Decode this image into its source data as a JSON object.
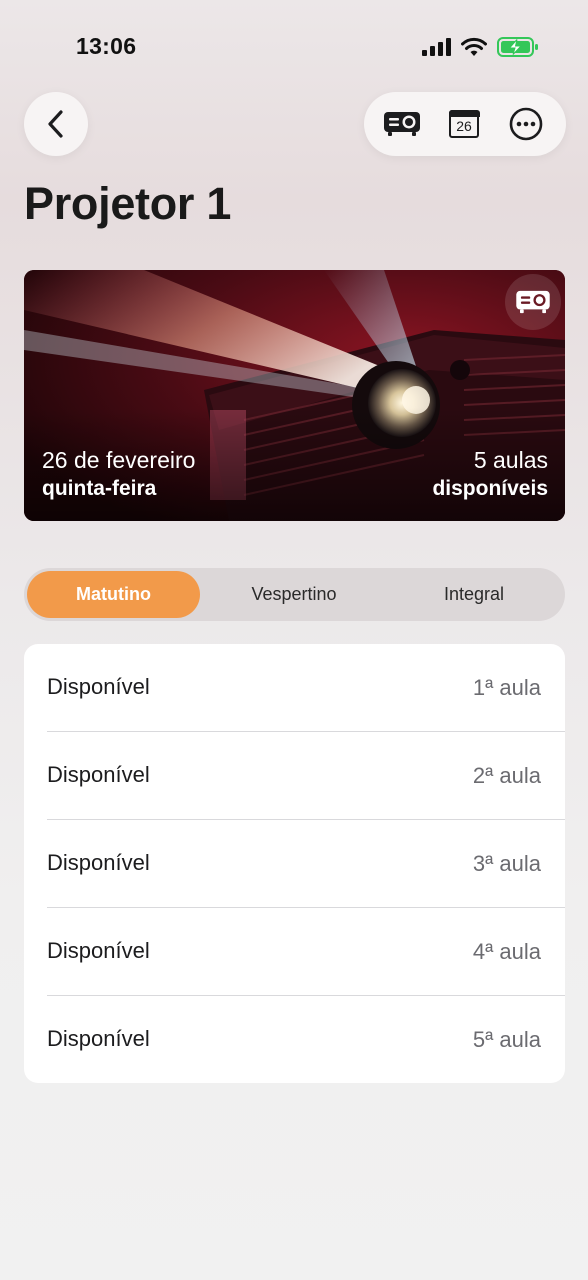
{
  "status_bar": {
    "time": "13:06"
  },
  "header": {
    "title": "Projetor 1",
    "calendar_day": "26"
  },
  "hero": {
    "date": "26 de fevereiro",
    "weekday": "quinta-feira",
    "count": "5 aulas",
    "count_label": "disponíveis"
  },
  "segments": [
    {
      "label": "Matutino",
      "selected": true
    },
    {
      "label": "Vespertino",
      "selected": false
    },
    {
      "label": "Integral",
      "selected": false
    }
  ],
  "slots": [
    {
      "status": "Disponível",
      "slot": "1ª aula"
    },
    {
      "status": "Disponível",
      "slot": "2ª aula"
    },
    {
      "status": "Disponível",
      "slot": "3ª aula"
    },
    {
      "status": "Disponível",
      "slot": "4ª aula"
    },
    {
      "status": "Disponível",
      "slot": "5ª aula"
    }
  ],
  "colors": {
    "accent": "#f29a4a",
    "battery": "#34c759"
  },
  "icons": [
    "chevron-left-icon",
    "projector-icon",
    "calendar-icon",
    "ellipsis-circle-icon"
  ]
}
